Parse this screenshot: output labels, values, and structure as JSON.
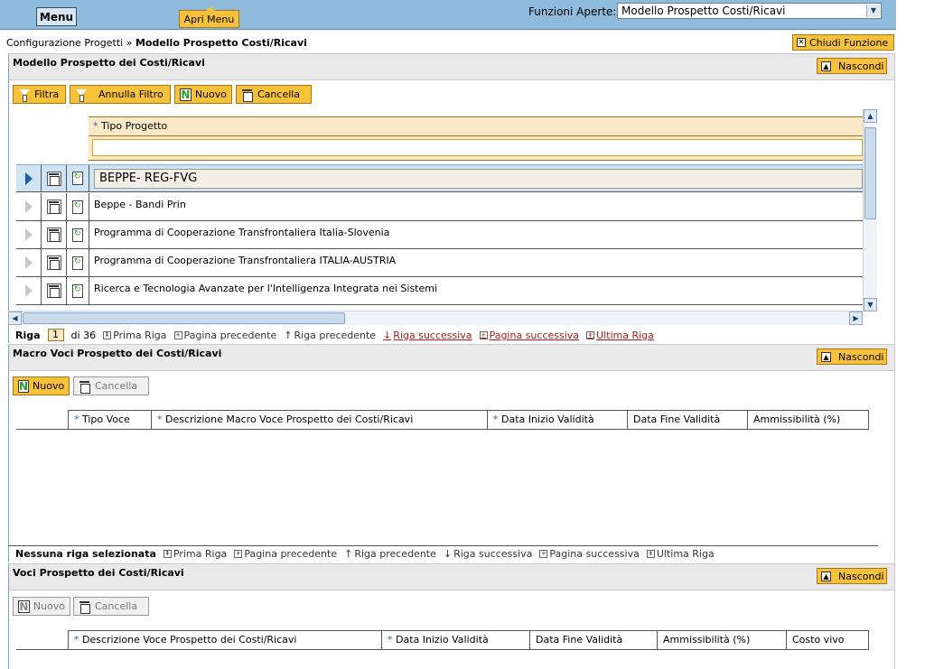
{
  "topbar": {
    "menu_label": "Menu",
    "apri_menu_label": "Apri Menu",
    "funzioni_label": "Funzioni Aperte:",
    "funzioni_value": "Modello Prospetto Costi/Ricavi"
  },
  "breadcrumb": {
    "parent": "Configurazione Progetti",
    "separator": "»",
    "current": "Modello Prospetto Costi/Ricavi"
  },
  "chiudi_label": "Chiudi Funzione",
  "nascondi_label": "Nascondi",
  "section1": {
    "title": "Modello Prospetto dei Costi/Ricavi",
    "buttons": {
      "filtra": "Filtra",
      "annulla_filtro": "Annulla Filtro",
      "nuovo": "Nuovo",
      "cancella": "Cancella"
    },
    "column_header": "Tipo Progetto",
    "rows": [
      "BEPPE- REG-FVG",
      "Beppe - Bandi Prin",
      "Programma di Cooperazione Transfrontaliera Italia-Slovenia",
      "Programma di Cooperazione Transfrontaliera ITALIA-AUSTRIA",
      "Ricerca e Tecnologia Avanzate per l'Intelligenza Integrata nei Sistemi"
    ],
    "pager": {
      "label": "Riga",
      "current": "1",
      "of": "di 36",
      "prima": "Prima Riga",
      "pag_prec": "Pagina precedente",
      "riga_prec": "Riga precedente",
      "riga_succ": "Riga successiva",
      "pag_succ": "Pagina successiva",
      "ultima": "Ultima Riga"
    }
  },
  "section2": {
    "title": "Macro Voci Prospetto dei Costi/Ricavi",
    "buttons": {
      "nuovo": "Nuovo",
      "cancella": "Cancella"
    },
    "columns": [
      "Tipo Voce",
      "Descrizione Macro Voce Prospetto dei Costi/Ricavi",
      "Data Inizio Validità",
      "Data Fine Validità",
      "Ammissibilità (%)"
    ],
    "pager": {
      "label": "Nessuna riga selezionata",
      "prima": "Prima Riga",
      "pag_prec": "Pagina precedente",
      "riga_prec": "Riga precedente",
      "riga_succ": "Riga successiva",
      "pag_succ": "Pagina successiva",
      "ultima": "Ultima Riga"
    }
  },
  "section3": {
    "title": "Voci Prospetto dei Costi/Ricavi",
    "buttons": {
      "nuovo": "Nuovo",
      "cancella": "Cancella"
    },
    "columns": [
      "Descrizione Voce Prospetto dei Costi/Ricavi",
      "Data Inizio Validità",
      "Data Fine Validità",
      "Ammissibilità (%)",
      "Costo vivo"
    ]
  },
  "required_marker": "*"
}
